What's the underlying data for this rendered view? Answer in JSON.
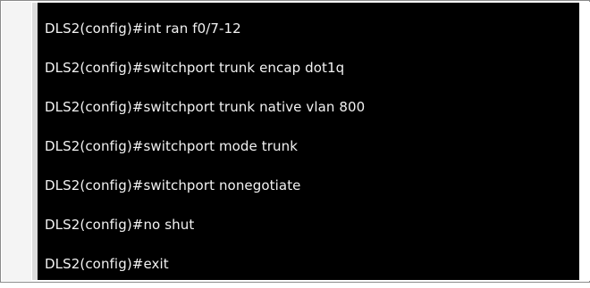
{
  "terminal": {
    "lines": [
      "DLS2(config)#int ran f0/7-12",
      "DLS2(config)#switchport trunk encap dot1q",
      "DLS2(config)#switchport trunk native vlan 800",
      "DLS2(config)#switchport mode trunk",
      "DLS2(config)#switchport nonegotiate",
      "DLS2(config)#no shut",
      "DLS2(config)#exit"
    ]
  },
  "colors": {
    "terminal_background": "#000000",
    "terminal_text": "#f2f2f2",
    "frame_border": "#8a8a8a"
  }
}
